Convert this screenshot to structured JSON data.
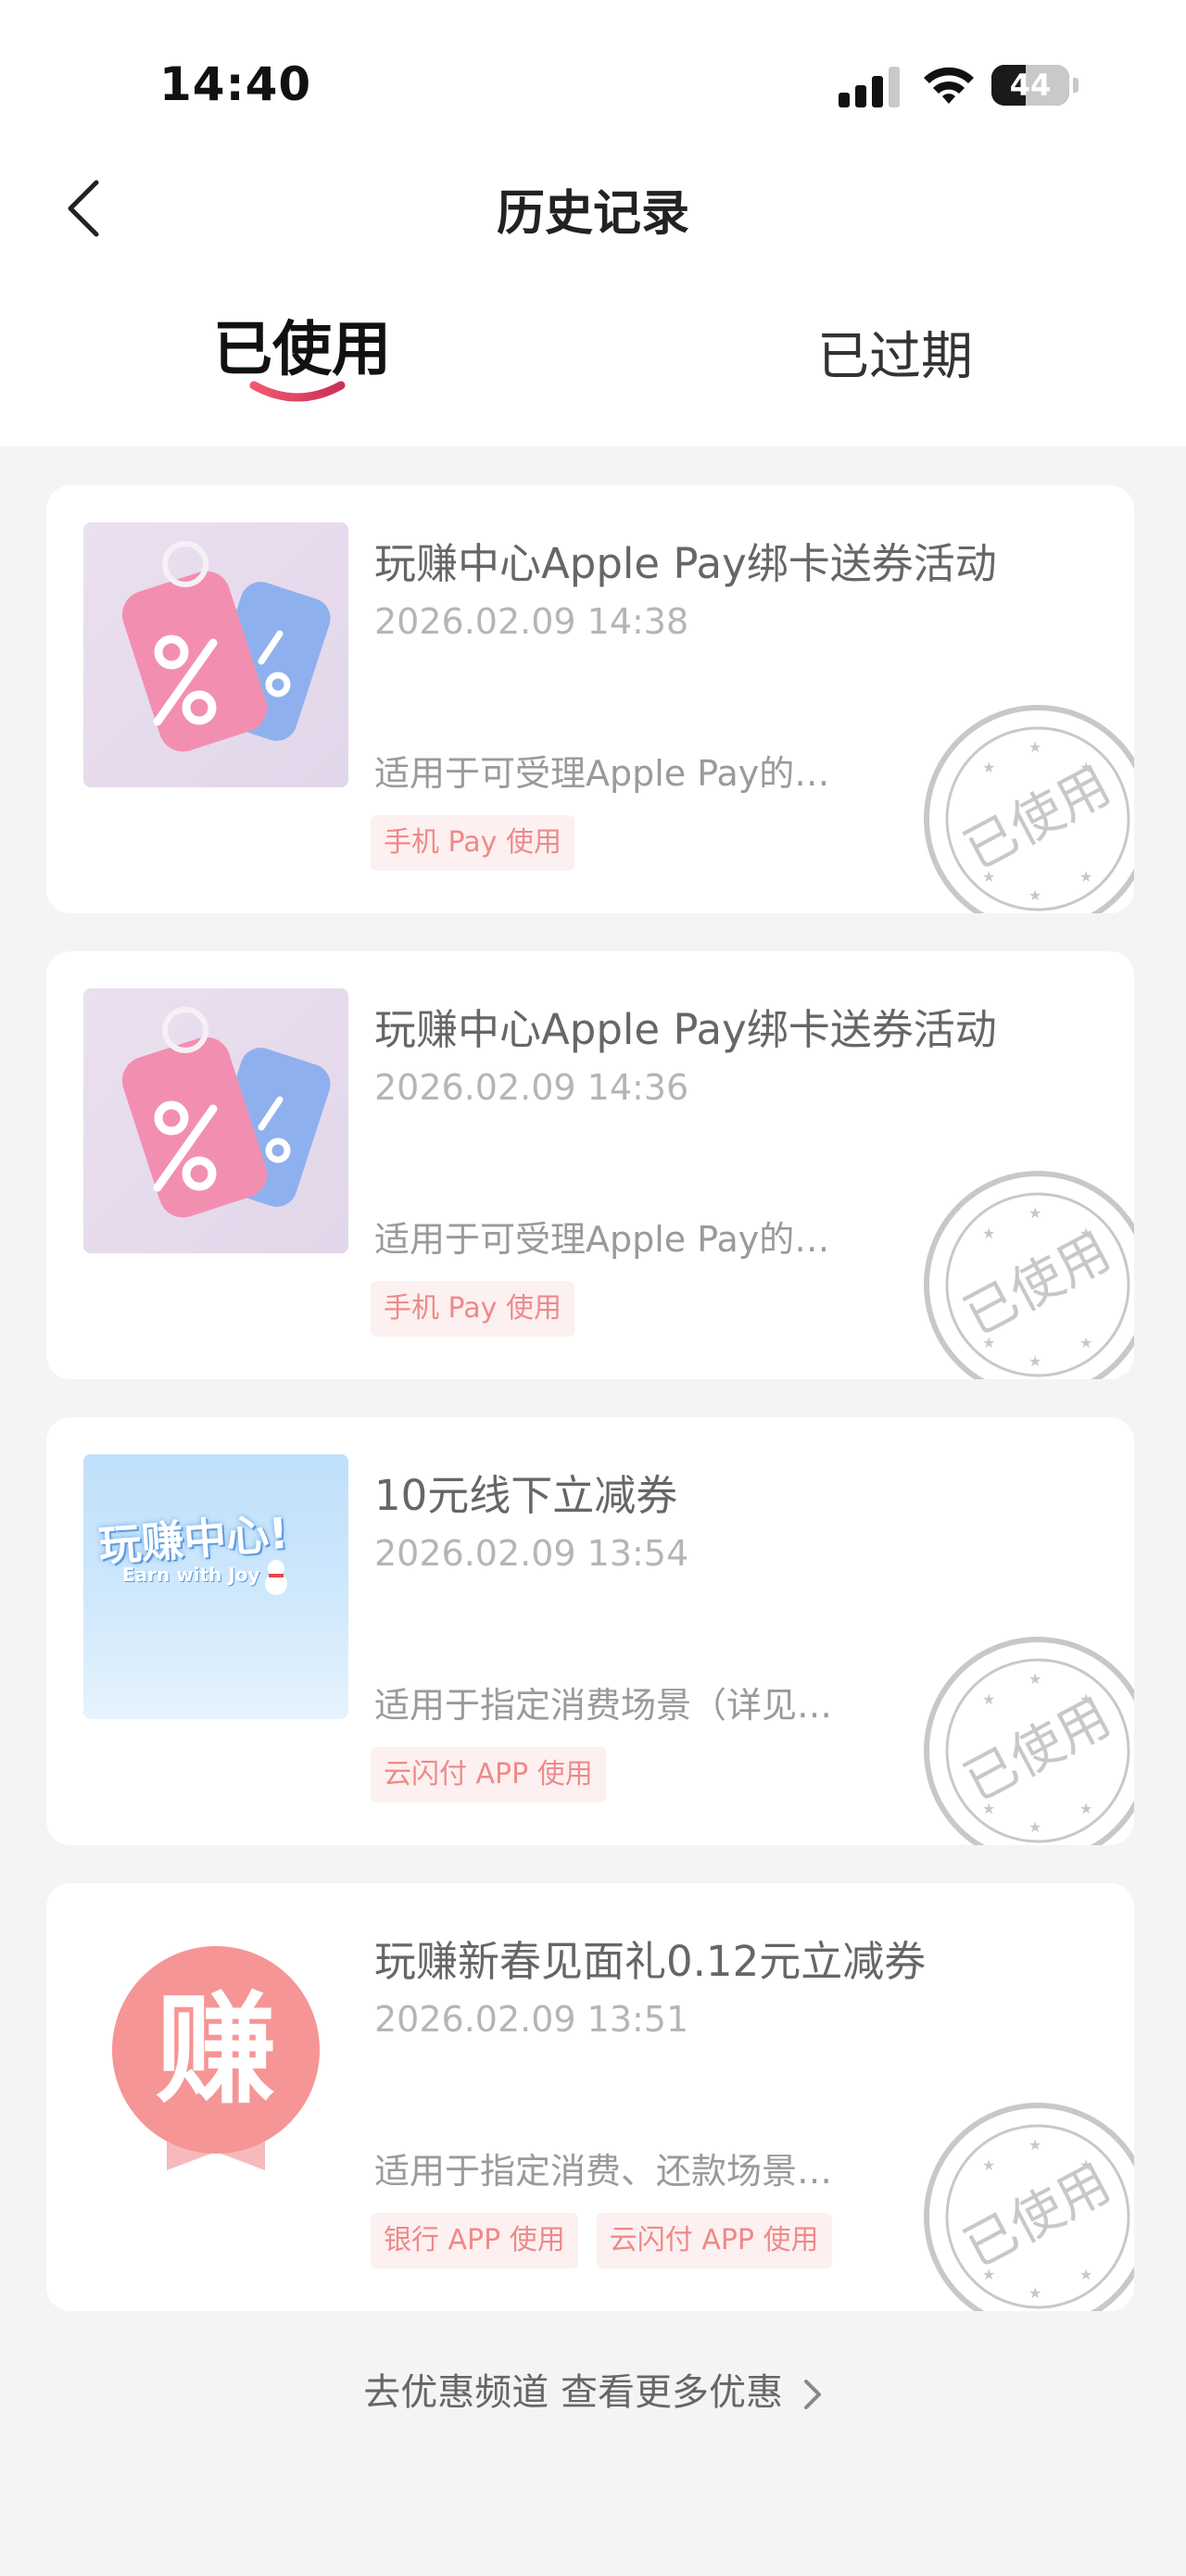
{
  "status_bar": {
    "time": "14:40",
    "battery": "44"
  },
  "header": {
    "title": "历史记录"
  },
  "tabs": [
    {
      "label": "已使用",
      "active": true
    },
    {
      "label": "已过期",
      "active": false
    }
  ],
  "stamp_text": "已使用",
  "coupons": [
    {
      "title": "玩赚中心Apple Pay绑卡送券活动",
      "time": "2026.02.09 14:38",
      "desc": "适用于可受理Apple Pay的…",
      "tags": [
        "手机 Pay 使用"
      ],
      "image": "discount-tag-icon"
    },
    {
      "title": "玩赚中心Apple Pay绑卡送券活动",
      "time": "2026.02.09 14:36",
      "desc": "适用于可受理Apple Pay的…",
      "tags": [
        "手机 Pay 使用"
      ],
      "image": "discount-tag-icon"
    },
    {
      "title": "10元线下立减券",
      "time": "2026.02.09 13:54",
      "desc": "适用于指定消费场景（详见…",
      "tags": [
        "云闪付 APP 使用"
      ],
      "image": "earn-center-banner",
      "banner_title": "玩赚中心!",
      "banner_subtitle": "Earn with Joy"
    },
    {
      "title": "玩赚新春见面礼0.12元立减券",
      "time": "2026.02.09 13:51",
      "desc": "适用于指定消费、还款场景…",
      "tags": [
        "银行 APP 使用",
        "云闪付 APP 使用"
      ],
      "image": "earn-badge-icon",
      "badge_char": "赚"
    }
  ],
  "footer": {
    "link": "去优惠频道 查看更多优惠"
  },
  "colors": {
    "accent": "#e8475f",
    "tag_bg": "#fdf0f0",
    "tag_text": "#ee8a8a",
    "stamp": "#c8c8c8"
  }
}
